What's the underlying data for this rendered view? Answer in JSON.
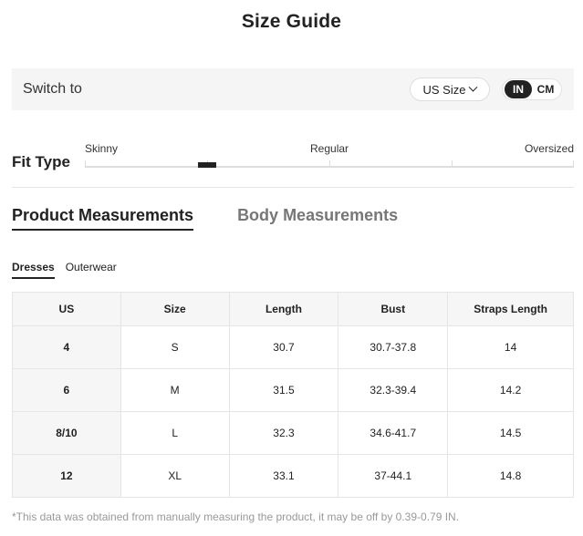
{
  "title": "Size Guide",
  "switch": {
    "label": "Switch to",
    "size_select": "US Size",
    "units": [
      "IN",
      "CM"
    ],
    "active_unit": "IN"
  },
  "fit": {
    "label": "Fit Type",
    "options": [
      "Skinny",
      "Regular",
      "Oversized"
    ]
  },
  "tabs": [
    "Product Measurements",
    "Body Measurements"
  ],
  "sub_tabs": [
    "Dresses",
    "Outerwear"
  ],
  "table": {
    "headers": [
      "US",
      "Size",
      "Length",
      "Bust",
      "Straps Length"
    ],
    "rows": [
      [
        "4",
        "S",
        "30.7",
        "30.7-37.8",
        "14"
      ],
      [
        "6",
        "M",
        "31.5",
        "32.3-39.4",
        "14.2"
      ],
      [
        "8/10",
        "L",
        "32.3",
        "34.6-41.7",
        "14.5"
      ],
      [
        "12",
        "XL",
        "33.1",
        "37-44.1",
        "14.8"
      ]
    ]
  },
  "footnote": "*This data was obtained from manually measuring the product, it may be off by 0.39-0.79 IN."
}
